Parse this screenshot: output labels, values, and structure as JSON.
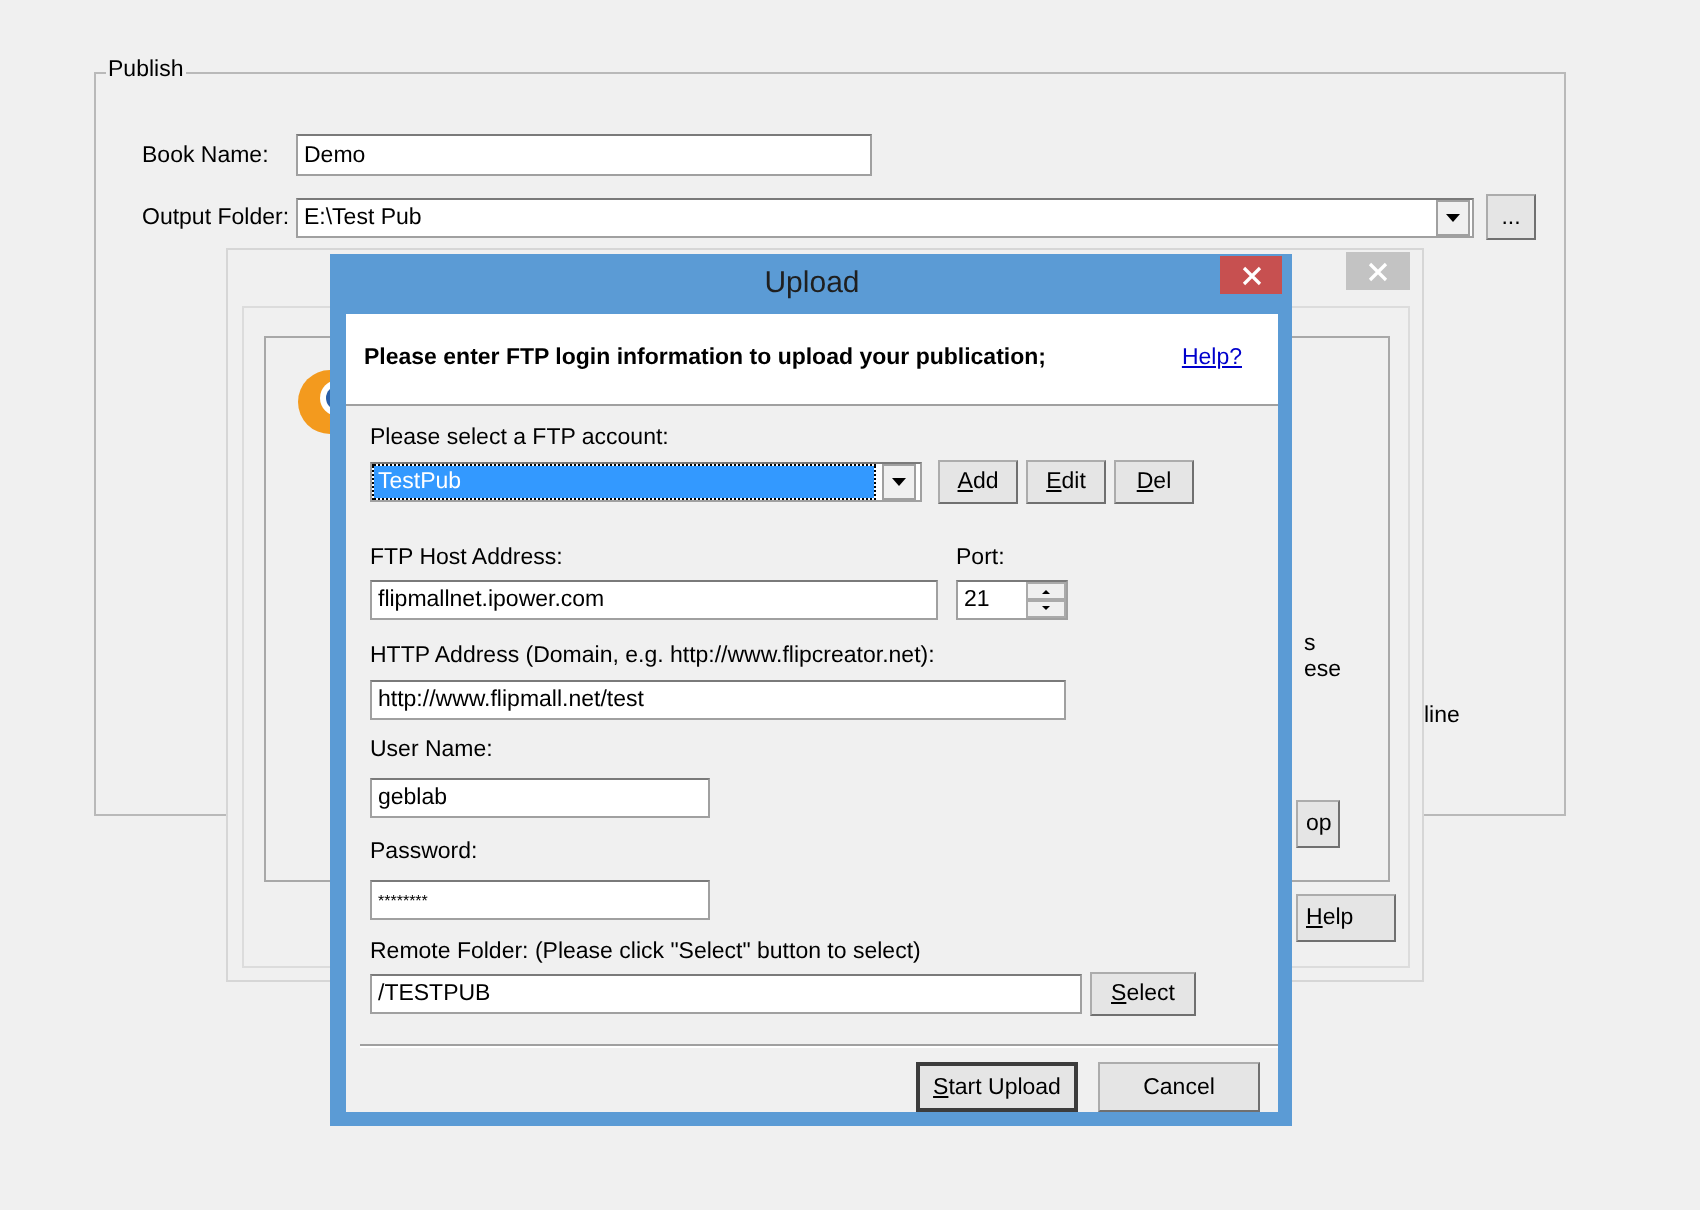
{
  "publish": {
    "group_title": "Publish",
    "book_name_label": "Book Name:",
    "book_name": "Demo",
    "output_folder_label": "Output Folder:",
    "output_folder": "E:\\Test Pub",
    "browse_button": "...",
    "partial_text": "line"
  },
  "back_window": {
    "texts": [
      "s",
      "ese"
    ],
    "buttons": [
      {
        "label": "op",
        "mnemonic": false
      },
      {
        "label": "Help",
        "mnemonic": true
      }
    ]
  },
  "upload": {
    "title": "Upload",
    "header": "Please enter FTP login information to upload your publication;",
    "help_link": "Help?",
    "account_label": "Please select a FTP account:",
    "account": "TestPub",
    "account_buttons": [
      {
        "label": "Add",
        "mnemonic": true
      },
      {
        "label": "Edit",
        "mnemonic": true
      },
      {
        "label": "Del",
        "mnemonic": true
      }
    ],
    "host_label": "FTP Host Address:",
    "host": "flipmallnet.ipower.com",
    "port_label": "Port:",
    "port": "21",
    "http_label": "HTTP Address (Domain, e.g. http://www.flipcreator.net):",
    "http": "http://www.flipmall.net/test",
    "user_label": "User Name:",
    "user": "geblab",
    "password_label": "Password:",
    "password": "********",
    "remote_label": "Remote Folder: (Please click \"Select\" button to select)",
    "remote": "/TESTPUB",
    "select_button": {
      "label": "Select",
      "mnemonic": true
    },
    "actions": [
      {
        "label": "Start Upload",
        "mnemonic": true,
        "default": true
      },
      {
        "label": "Cancel",
        "mnemonic": false,
        "default": false
      }
    ]
  }
}
